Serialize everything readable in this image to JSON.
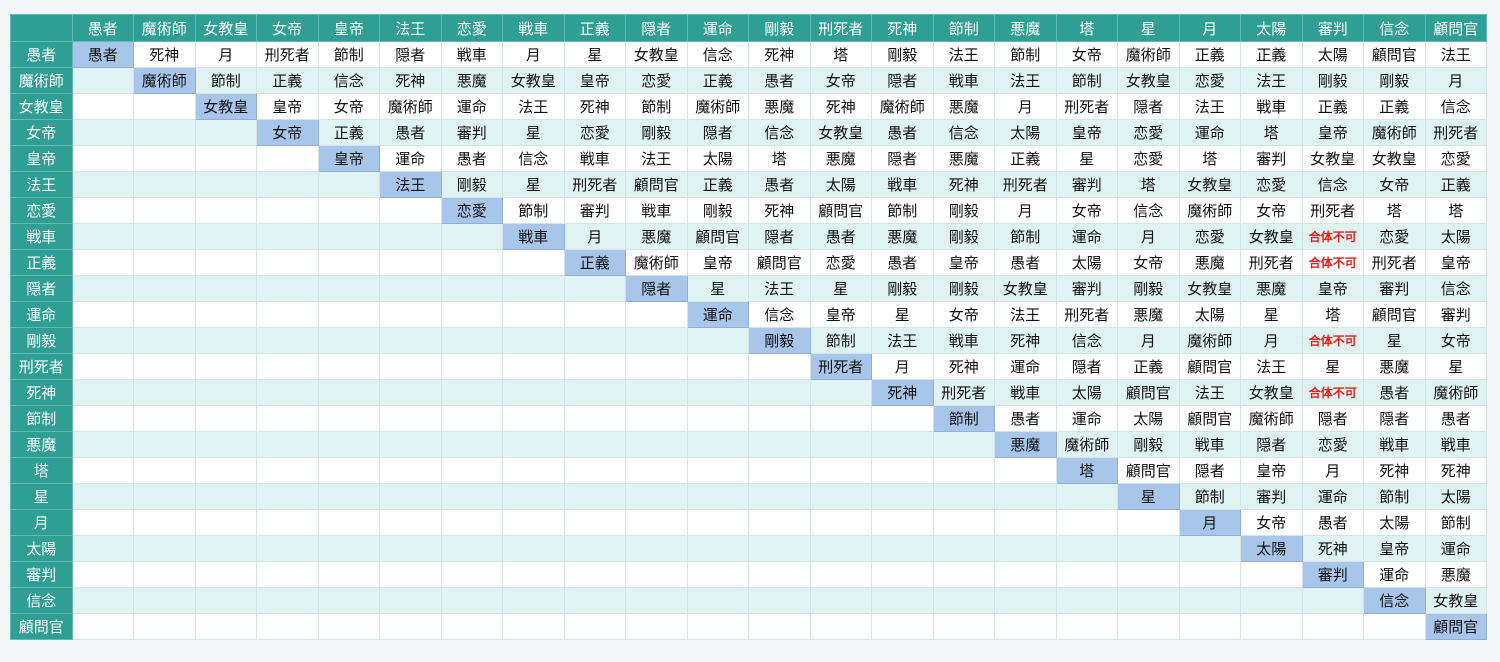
{
  "arcanas": [
    "愚者",
    "魔術師",
    "女教皇",
    "女帝",
    "皇帝",
    "法王",
    "恋愛",
    "戦車",
    "正義",
    "隠者",
    "運命",
    "剛毅",
    "刑死者",
    "死神",
    "節制",
    "悪魔",
    "塔",
    "星",
    "月",
    "太陽",
    "審判",
    "信念",
    "顧問官"
  ],
  "rows": [
    [
      "愚者",
      "死神",
      "月",
      "刑死者",
      "節制",
      "隠者",
      "戦車",
      "月",
      "星",
      "女教皇",
      "信念",
      "死神",
      "塔",
      "剛毅",
      "法王",
      "節制",
      "女帝",
      "魔術師",
      "正義",
      "正義",
      "太陽",
      "顧問官",
      "法王"
    ],
    [
      "",
      "魔術師",
      "節制",
      "正義",
      "信念",
      "死神",
      "悪魔",
      "女教皇",
      "皇帝",
      "恋愛",
      "正義",
      "愚者",
      "女帝",
      "隠者",
      "戦車",
      "法王",
      "節制",
      "女教皇",
      "恋愛",
      "法王",
      "剛毅",
      "剛毅",
      "月"
    ],
    [
      "",
      "",
      "女教皇",
      "皇帝",
      "女帝",
      "魔術師",
      "運命",
      "法王",
      "死神",
      "節制",
      "魔術師",
      "悪魔",
      "死神",
      "魔術師",
      "悪魔",
      "月",
      "刑死者",
      "隠者",
      "法王",
      "戦車",
      "正義",
      "正義",
      "信念"
    ],
    [
      "",
      "",
      "",
      "女帝",
      "正義",
      "愚者",
      "審判",
      "星",
      "恋愛",
      "剛毅",
      "隠者",
      "信念",
      "女教皇",
      "愚者",
      "信念",
      "太陽",
      "皇帝",
      "恋愛",
      "運命",
      "塔",
      "皇帝",
      "魔術師",
      "刑死者"
    ],
    [
      "",
      "",
      "",
      "",
      "皇帝",
      "運命",
      "愚者",
      "信念",
      "戦車",
      "法王",
      "太陽",
      "塔",
      "悪魔",
      "隠者",
      "悪魔",
      "正義",
      "星",
      "恋愛",
      "塔",
      "審判",
      "女教皇",
      "女教皇",
      "恋愛"
    ],
    [
      "",
      "",
      "",
      "",
      "",
      "法王",
      "剛毅",
      "星",
      "刑死者",
      "顧問官",
      "正義",
      "愚者",
      "太陽",
      "戦車",
      "死神",
      "刑死者",
      "審判",
      "塔",
      "女教皇",
      "恋愛",
      "信念",
      "女帝",
      "正義"
    ],
    [
      "",
      "",
      "",
      "",
      "",
      "",
      "恋愛",
      "節制",
      "審判",
      "戦車",
      "剛毅",
      "死神",
      "顧問官",
      "節制",
      "剛毅",
      "月",
      "女帝",
      "信念",
      "魔術師",
      "女帝",
      "刑死者",
      "塔",
      "塔"
    ],
    [
      "",
      "",
      "",
      "",
      "",
      "",
      "",
      "戦車",
      "月",
      "悪魔",
      "顧問官",
      "隠者",
      "愚者",
      "悪魔",
      "剛毅",
      "節制",
      "運命",
      "月",
      "恋愛",
      "女教皇",
      "合体不可",
      "恋愛",
      "太陽"
    ],
    [
      "",
      "",
      "",
      "",
      "",
      "",
      "",
      "",
      "正義",
      "魔術師",
      "皇帝",
      "顧問官",
      "恋愛",
      "愚者",
      "皇帝",
      "愚者",
      "太陽",
      "女帝",
      "悪魔",
      "刑死者",
      "合体不可",
      "刑死者",
      "皇帝"
    ],
    [
      "",
      "",
      "",
      "",
      "",
      "",
      "",
      "",
      "",
      "隠者",
      "星",
      "法王",
      "星",
      "剛毅",
      "剛毅",
      "女教皇",
      "審判",
      "剛毅",
      "女教皇",
      "悪魔",
      "皇帝",
      "審判",
      "信念"
    ],
    [
      "",
      "",
      "",
      "",
      "",
      "",
      "",
      "",
      "",
      "",
      "運命",
      "信念",
      "皇帝",
      "星",
      "女帝",
      "法王",
      "刑死者",
      "悪魔",
      "太陽",
      "星",
      "塔",
      "顧問官",
      "審判"
    ],
    [
      "",
      "",
      "",
      "",
      "",
      "",
      "",
      "",
      "",
      "",
      "",
      "剛毅",
      "節制",
      "法王",
      "戦車",
      "死神",
      "信念",
      "月",
      "魔術師",
      "月",
      "合体不可",
      "星",
      "女帝"
    ],
    [
      "",
      "",
      "",
      "",
      "",
      "",
      "",
      "",
      "",
      "",
      "",
      "",
      "刑死者",
      "月",
      "死神",
      "運命",
      "隠者",
      "正義",
      "顧問官",
      "法王",
      "星",
      "悪魔",
      "星"
    ],
    [
      "",
      "",
      "",
      "",
      "",
      "",
      "",
      "",
      "",
      "",
      "",
      "",
      "",
      "死神",
      "刑死者",
      "戦車",
      "太陽",
      "顧問官",
      "法王",
      "女教皇",
      "合体不可",
      "愚者",
      "魔術師"
    ],
    [
      "",
      "",
      "",
      "",
      "",
      "",
      "",
      "",
      "",
      "",
      "",
      "",
      "",
      "",
      "節制",
      "愚者",
      "運命",
      "太陽",
      "顧問官",
      "魔術師",
      "隠者",
      "隠者",
      "愚者"
    ],
    [
      "",
      "",
      "",
      "",
      "",
      "",
      "",
      "",
      "",
      "",
      "",
      "",
      "",
      "",
      "",
      "悪魔",
      "魔術師",
      "剛毅",
      "戦車",
      "隠者",
      "恋愛",
      "戦車",
      "戦車"
    ],
    [
      "",
      "",
      "",
      "",
      "",
      "",
      "",
      "",
      "",
      "",
      "",
      "",
      "",
      "",
      "",
      "",
      "塔",
      "顧問官",
      "隠者",
      "皇帝",
      "月",
      "死神",
      "死神"
    ],
    [
      "",
      "",
      "",
      "",
      "",
      "",
      "",
      "",
      "",
      "",
      "",
      "",
      "",
      "",
      "",
      "",
      "",
      "星",
      "節制",
      "審判",
      "運命",
      "節制",
      "太陽"
    ],
    [
      "",
      "",
      "",
      "",
      "",
      "",
      "",
      "",
      "",
      "",
      "",
      "",
      "",
      "",
      "",
      "",
      "",
      "",
      "月",
      "女帝",
      "愚者",
      "太陽",
      "節制"
    ],
    [
      "",
      "",
      "",
      "",
      "",
      "",
      "",
      "",
      "",
      "",
      "",
      "",
      "",
      "",
      "",
      "",
      "",
      "",
      "",
      "太陽",
      "死神",
      "皇帝",
      "運命"
    ],
    [
      "",
      "",
      "",
      "",
      "",
      "",
      "",
      "",
      "",
      "",
      "",
      "",
      "",
      "",
      "",
      "",
      "",
      "",
      "",
      "",
      "審判",
      "運命",
      "悪魔"
    ],
    [
      "",
      "",
      "",
      "",
      "",
      "",
      "",
      "",
      "",
      "",
      "",
      "",
      "",
      "",
      "",
      "",
      "",
      "",
      "",
      "",
      "",
      "信念",
      "女教皇"
    ],
    [
      "",
      "",
      "",
      "",
      "",
      "",
      "",
      "",
      "",
      "",
      "",
      "",
      "",
      "",
      "",
      "",
      "",
      "",
      "",
      "",
      "",
      "",
      "顧問官"
    ]
  ],
  "special_values": {
    "not_possible": "合体不可"
  },
  "colors": {
    "header_bg": "#2e9f92",
    "header_text": "#ffffff",
    "stripe_odd": "#def3f2",
    "stripe_even": "#ffffff",
    "diagonal": "#a7c6ea",
    "not_possible_text": "#e8201a"
  }
}
